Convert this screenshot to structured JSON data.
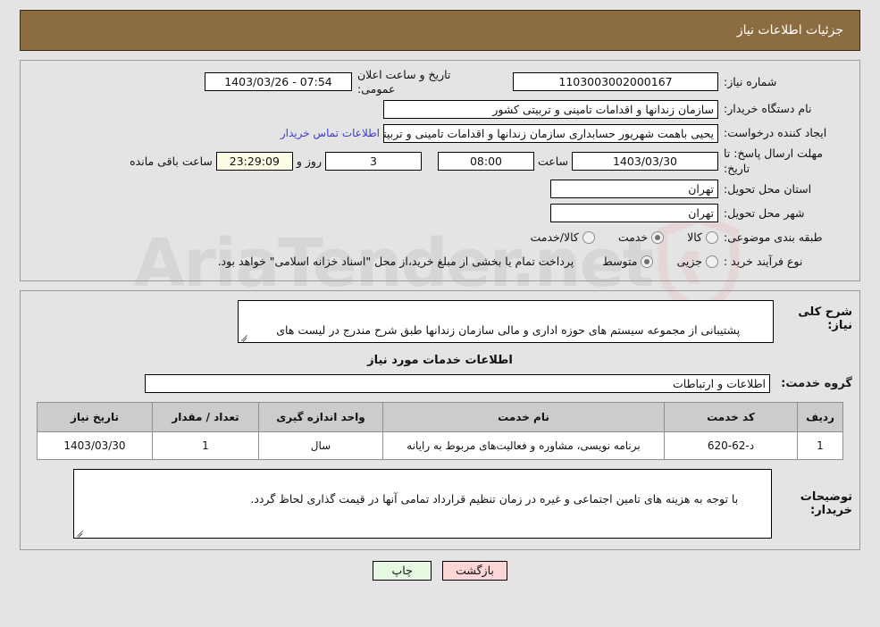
{
  "header": {
    "title": "جزئیات اطلاعات نیاز"
  },
  "watermark": {
    "text": "AriaTender.net",
    "shield_color": "#e9b8bc",
    "text_color": "#b9b9b9"
  },
  "top_section": {
    "need_number": {
      "label": "شماره نیاز:",
      "value": "1103003002000167"
    },
    "public_announce": {
      "label": "تاریخ و ساعت اعلان عمومی:",
      "value": "07:54 - 1403/03/26"
    },
    "buyer_org": {
      "label": "نام دستگاه خریدار:",
      "value": "سازمان زندانها و اقدامات تامینی و تربیتی کشور"
    },
    "requester": {
      "label": "ایجاد کننده درخواست:",
      "value": "یحیی باهمت شهریور حسابداری سازمان زندانها و اقدامات تامینی و تربیتی کشو",
      "contact_link": "اطلاعات تماس خریدار"
    },
    "deadline": {
      "label": "مهلت ارسال پاسخ: تا تاریخ:",
      "date": "1403/03/30",
      "time_label": "ساعت",
      "time": "08:00",
      "days": "3",
      "days_label": "روز و",
      "countdown": "23:29:09",
      "countdown_label": "ساعت باقی مانده"
    },
    "delivery_province": {
      "label": "استان محل تحویل:",
      "value": "تهران"
    },
    "delivery_city": {
      "label": "شهر محل تحویل:",
      "value": "تهران"
    },
    "category": {
      "label": "طبقه بندی موضوعی:",
      "options": [
        {
          "label": "کالا",
          "selected": false
        },
        {
          "label": "خدمت",
          "selected": true
        },
        {
          "label": "کالا/خدمت",
          "selected": false
        }
      ]
    },
    "process_type": {
      "label": "نوع فرآیند خرید :",
      "options": [
        {
          "label": "جزیی",
          "selected": false
        },
        {
          "label": "متوسط",
          "selected": true
        }
      ],
      "treasury_note": "پرداخت تمام یا بخشی از مبلغ خرید،از محل \"اسناد خزانه اسلامی\" خواهد بود."
    }
  },
  "description_section": {
    "general_label": "شرح کلی نیاز:",
    "general_value": "پشتیبانی از مجموعه سیستم های حوزه اداری و مالی سازمان زندانها طبق شرح مندرج در لیست های\nپیوست (شش برگ) با تنظیم قرارداد",
    "services_heading": "اطلاعات خدمات مورد نیاز",
    "service_group_label": "گروه خدمت:",
    "service_group_value": "اطلاعات و ارتباطات",
    "table": {
      "columns": [
        "ردیف",
        "کد خدمت",
        "نام خدمت",
        "واحد اندازه گیری",
        "تعداد / مقدار",
        "تاریخ نیاز"
      ],
      "rows": [
        {
          "row_no": "1",
          "service_code": "د-62-620",
          "service_name": "برنامه نویسی، مشاوره و فعالیت‌های مربوط به رایانه",
          "unit": "سال",
          "quantity": "1",
          "need_date": "1403/03/30"
        }
      ]
    },
    "buyer_notes_label": "توضیحات خریدار:",
    "buyer_notes_value": "با توجه به هزینه های تامین اجتماعی و غیره در زمان تنظیم قرارداد تمامی آنها در قیمت گذاری لحاظ گردد."
  },
  "footer": {
    "back_button": "بازگشت",
    "print_button": "چاپ"
  }
}
